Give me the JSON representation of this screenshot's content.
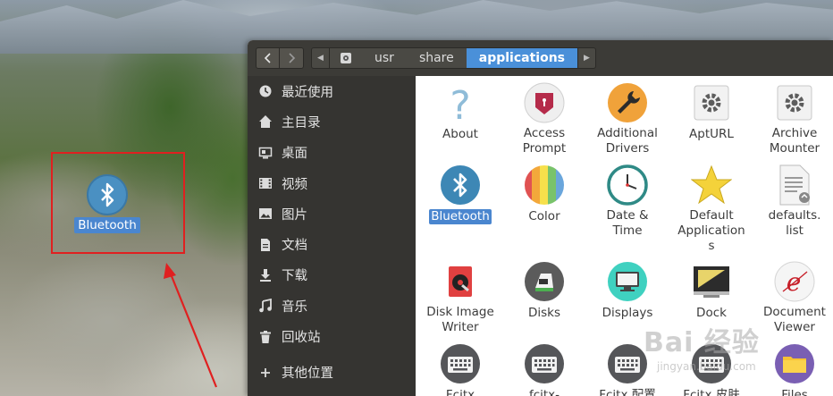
{
  "desktop": {
    "icon_label": "Bluetooth"
  },
  "window": {
    "path": {
      "crumbs": [
        "usr",
        "share",
        "applications"
      ],
      "active_index": 2
    },
    "sidebar": {
      "items": [
        {
          "label": "最近使用",
          "icon": "recent-icon"
        },
        {
          "label": "主目录",
          "icon": "home-icon"
        },
        {
          "label": "桌面",
          "icon": "desktop-icon"
        },
        {
          "label": "视频",
          "icon": "video-icon"
        },
        {
          "label": "图片",
          "icon": "picture-icon"
        },
        {
          "label": "文档",
          "icon": "document-icon"
        },
        {
          "label": "下载",
          "icon": "download-icon"
        },
        {
          "label": "音乐",
          "icon": "music-icon"
        },
        {
          "label": "回收站",
          "icon": "trash-icon"
        },
        {
          "label": "其他位置",
          "icon": "plus-icon"
        }
      ]
    },
    "apps": [
      {
        "label": "About",
        "icon": "question-icon"
      },
      {
        "label": "Access\nPrompt",
        "icon": "keyring-icon"
      },
      {
        "label": "Additional\nDrivers",
        "icon": "wrench-icon"
      },
      {
        "label": "AptURL",
        "icon": "gear-icon"
      },
      {
        "label": "Archive\nMounter",
        "icon": "gear-icon"
      },
      {
        "label": "Bluetooth",
        "icon": "bluetooth-icon",
        "selected": true
      },
      {
        "label": "Color",
        "icon": "color-icon"
      },
      {
        "label": "Date &\nTime",
        "icon": "clock-icon"
      },
      {
        "label": "Default\nApplication\ns",
        "icon": "star-icon"
      },
      {
        "label": "defaults.\nlist",
        "icon": "text-file-icon"
      },
      {
        "label": "Disk Image\nWriter",
        "icon": "disk-writer-icon"
      },
      {
        "label": "Disks",
        "icon": "disks-icon"
      },
      {
        "label": "Displays",
        "icon": "display-icon"
      },
      {
        "label": "Dock",
        "icon": "dock-icon"
      },
      {
        "label": "Document\nViewer",
        "icon": "document-viewer-icon"
      },
      {
        "label": "Fcitx",
        "icon": "keyboard-icon"
      },
      {
        "label": "fcitx-",
        "icon": "keyboard-icon"
      },
      {
        "label": "Fcitx 配置",
        "icon": "keyboard-icon"
      },
      {
        "label": "Fcitx 皮肤",
        "icon": "keyboard-icon"
      },
      {
        "label": "Files",
        "icon": "folder-icon"
      }
    ]
  },
  "watermark": {
    "text": "Bai 经验",
    "sub": "jingyan.baidu.com"
  }
}
